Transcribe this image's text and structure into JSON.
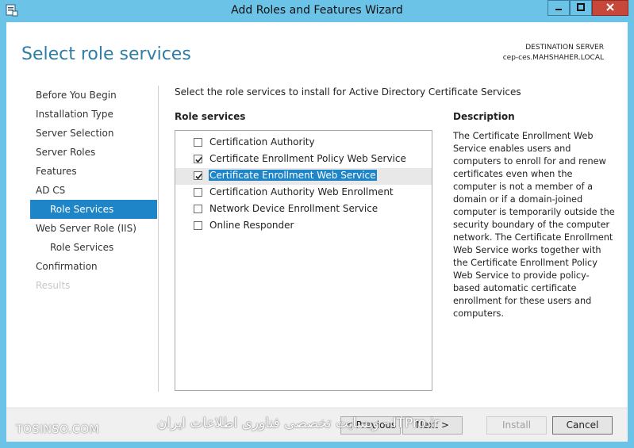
{
  "window": {
    "title": "Add Roles and Features Wizard",
    "minimize_icon": "minimize-icon",
    "maximize_icon": "maximize-icon",
    "close_icon": "close-icon"
  },
  "header": {
    "title": "Select role services",
    "destination_label": "DESTINATION SERVER",
    "destination_value": "cep-ces.MAHSHAHER.LOCAL"
  },
  "nav": {
    "items": [
      {
        "label": "Before You Begin",
        "state": "normal",
        "level": 0
      },
      {
        "label": "Installation Type",
        "state": "normal",
        "level": 0
      },
      {
        "label": "Server Selection",
        "state": "normal",
        "level": 0
      },
      {
        "label": "Server Roles",
        "state": "normal",
        "level": 0
      },
      {
        "label": "Features",
        "state": "normal",
        "level": 0
      },
      {
        "label": "AD CS",
        "state": "normal",
        "level": 0
      },
      {
        "label": "Role Services",
        "state": "active",
        "level": 1
      },
      {
        "label": "Web Server Role (IIS)",
        "state": "normal",
        "level": 0
      },
      {
        "label": "Role Services",
        "state": "normal",
        "level": 1
      },
      {
        "label": "Confirmation",
        "state": "normal",
        "level": 0
      },
      {
        "label": "Results",
        "state": "disabled",
        "level": 0
      }
    ]
  },
  "main": {
    "instruction": "Select the role services to install for Active Directory Certificate Services",
    "role_services_heading": "Role services",
    "role_services": [
      {
        "label": "Certification Authority",
        "checked": false,
        "selected": false
      },
      {
        "label": "Certificate Enrollment Policy Web Service",
        "checked": true,
        "selected": false
      },
      {
        "label": "Certificate Enrollment Web Service",
        "checked": true,
        "selected": true
      },
      {
        "label": "Certification Authority Web Enrollment",
        "checked": false,
        "selected": false
      },
      {
        "label": "Network Device Enrollment Service",
        "checked": false,
        "selected": false
      },
      {
        "label": "Online Responder",
        "checked": false,
        "selected": false
      }
    ],
    "description_heading": "Description",
    "description": "The Certificate Enrollment Web Service enables users and computers to enroll for and renew certificates even when the computer is not a member of a domain or if a domain-joined computer is temporarily outside the security boundary of the computer network. The Certificate Enrollment Web Service works together with the Certificate Enrollment Policy Web Service to provide policy-based automatic certificate enrollment for these users and computers."
  },
  "footer": {
    "previous_label": "< Previous",
    "next_label": "Next >",
    "install_label": "Install",
    "cancel_label": "Cancel",
    "watermark_left": "TOSINSO.COM",
    "watermark_right": "وبسایت تخصصی فناوری اطلاعات ایران - ITPro.ir"
  },
  "colors": {
    "title_bar": "#6cc3e8",
    "accent": "#1e86c8",
    "header_title": "#2f7da6",
    "close_button": "#c7473a"
  }
}
